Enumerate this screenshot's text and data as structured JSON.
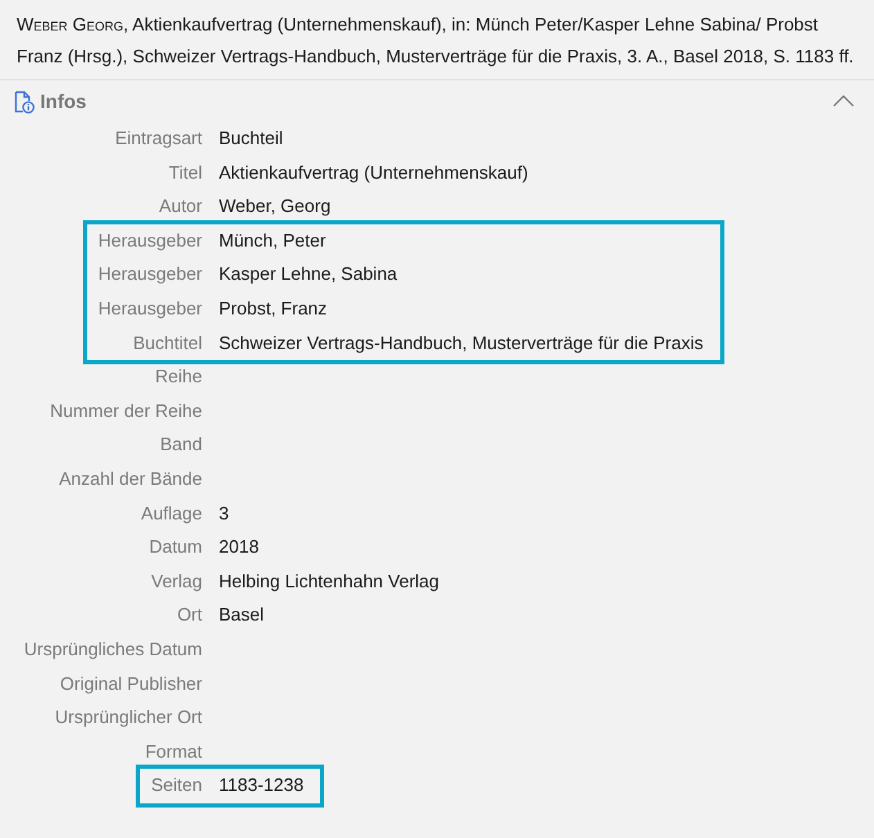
{
  "citation": {
    "author": "Weber Georg",
    "text": ", Aktienkaufvertrag (Unternehmenskauf), in: Münch Peter/Kasper Lehne Sabina/ Probst Franz (Hrsg.), Schweizer Vertrags-Handbuch, Musterverträge für die Praxis, 3. A., Basel 2018, S. 1183 ff."
  },
  "section": {
    "title": "Infos",
    "expanded": true
  },
  "fields": [
    {
      "label": "Eintragsart",
      "value": "Buchteil",
      "highlighted": false
    },
    {
      "label": "Titel",
      "value": "Aktienkaufvertrag (Unternehmenskauf)",
      "highlighted": false
    },
    {
      "label": "Autor",
      "value": "Weber, Georg",
      "highlighted": false
    },
    {
      "label": "Herausgeber",
      "value": "Münch, Peter",
      "highlighted": true
    },
    {
      "label": "Herausgeber",
      "value": "Kasper Lehne, Sabina",
      "highlighted": true
    },
    {
      "label": "Herausgeber",
      "value": "Probst, Franz",
      "highlighted": true
    },
    {
      "label": "Buchtitel",
      "value": "Schweizer Vertrags-Handbuch, Musterverträge für die Praxis",
      "highlighted": true
    },
    {
      "label": "Reihe",
      "highlighted": false
    },
    {
      "label": "Nummer der Reihe",
      "highlighted": false
    },
    {
      "label": "Band",
      "highlighted": false
    },
    {
      "label": "Anzahl der Bände",
      "highlighted": false
    },
    {
      "label": "Auflage",
      "value": "3",
      "highlighted": false
    },
    {
      "label": "Datum",
      "value": "2018",
      "highlighted": false
    },
    {
      "label": "Verlag",
      "value": "Helbing Lichtenhahn Verlag",
      "highlighted": false
    },
    {
      "label": "Ort",
      "value": "Basel",
      "highlighted": false
    },
    {
      "label": "Ursprüngliches Datum",
      "highlighted": false
    },
    {
      "label": "Original Publisher",
      "highlighted": false
    },
    {
      "label": "Ursprünglicher Ort",
      "highlighted": false
    },
    {
      "label": "Format",
      "highlighted": false
    },
    {
      "label": "Seiten",
      "value": "1183-1238",
      "highlighted": true
    }
  ]
}
